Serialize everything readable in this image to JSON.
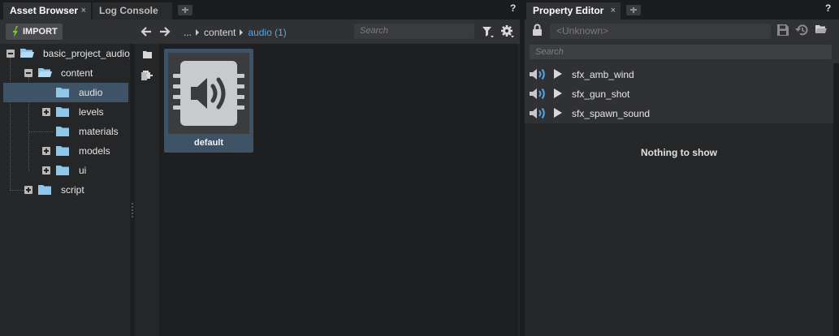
{
  "asset_browser": {
    "tab_label": "Asset Browser",
    "close_glyph": "×",
    "secondary_tab_label": "Log Console",
    "help_label": "?",
    "import_label": "IMPORT",
    "breadcrumb": {
      "ellipsis": "...",
      "items": [
        "content",
        "audio (1)"
      ]
    },
    "search_placeholder": "Search",
    "tree": [
      {
        "label": "basic_project_audio_",
        "expander": "minus",
        "icon": "folder-open-icon"
      },
      {
        "label": "content",
        "expander": "minus",
        "icon": "folder-open-icon"
      },
      {
        "label": "audio",
        "expander": "none",
        "icon": "folder-icon",
        "selected": true
      },
      {
        "label": "levels",
        "expander": "plus",
        "icon": "folder-icon"
      },
      {
        "label": "materials",
        "expander": "none",
        "icon": "folder-icon"
      },
      {
        "label": "models",
        "expander": "plus",
        "icon": "folder-icon"
      },
      {
        "label": "ui",
        "expander": "plus",
        "icon": "folder-icon"
      },
      {
        "label": "script",
        "expander": "plus",
        "icon": "folder-icon"
      }
    ],
    "assets": [
      {
        "label": "default",
        "icon": "sound-bank-icon"
      }
    ]
  },
  "property_editor": {
    "tab_label": "Property Editor",
    "close_glyph": "×",
    "help_label": "?",
    "object_field_value": "<Unknown>",
    "search_placeholder": "Search",
    "items": [
      {
        "label": "sfx_amb_wind"
      },
      {
        "label": "sfx_gun_shot"
      },
      {
        "label": "sfx_spawn_sound"
      }
    ],
    "empty_message": "Nothing to show"
  },
  "colors": {
    "accent_blue": "#53a7e6",
    "selection": "#3f5366",
    "folder": "#8fc6ea",
    "import_green": "#7fc241"
  }
}
